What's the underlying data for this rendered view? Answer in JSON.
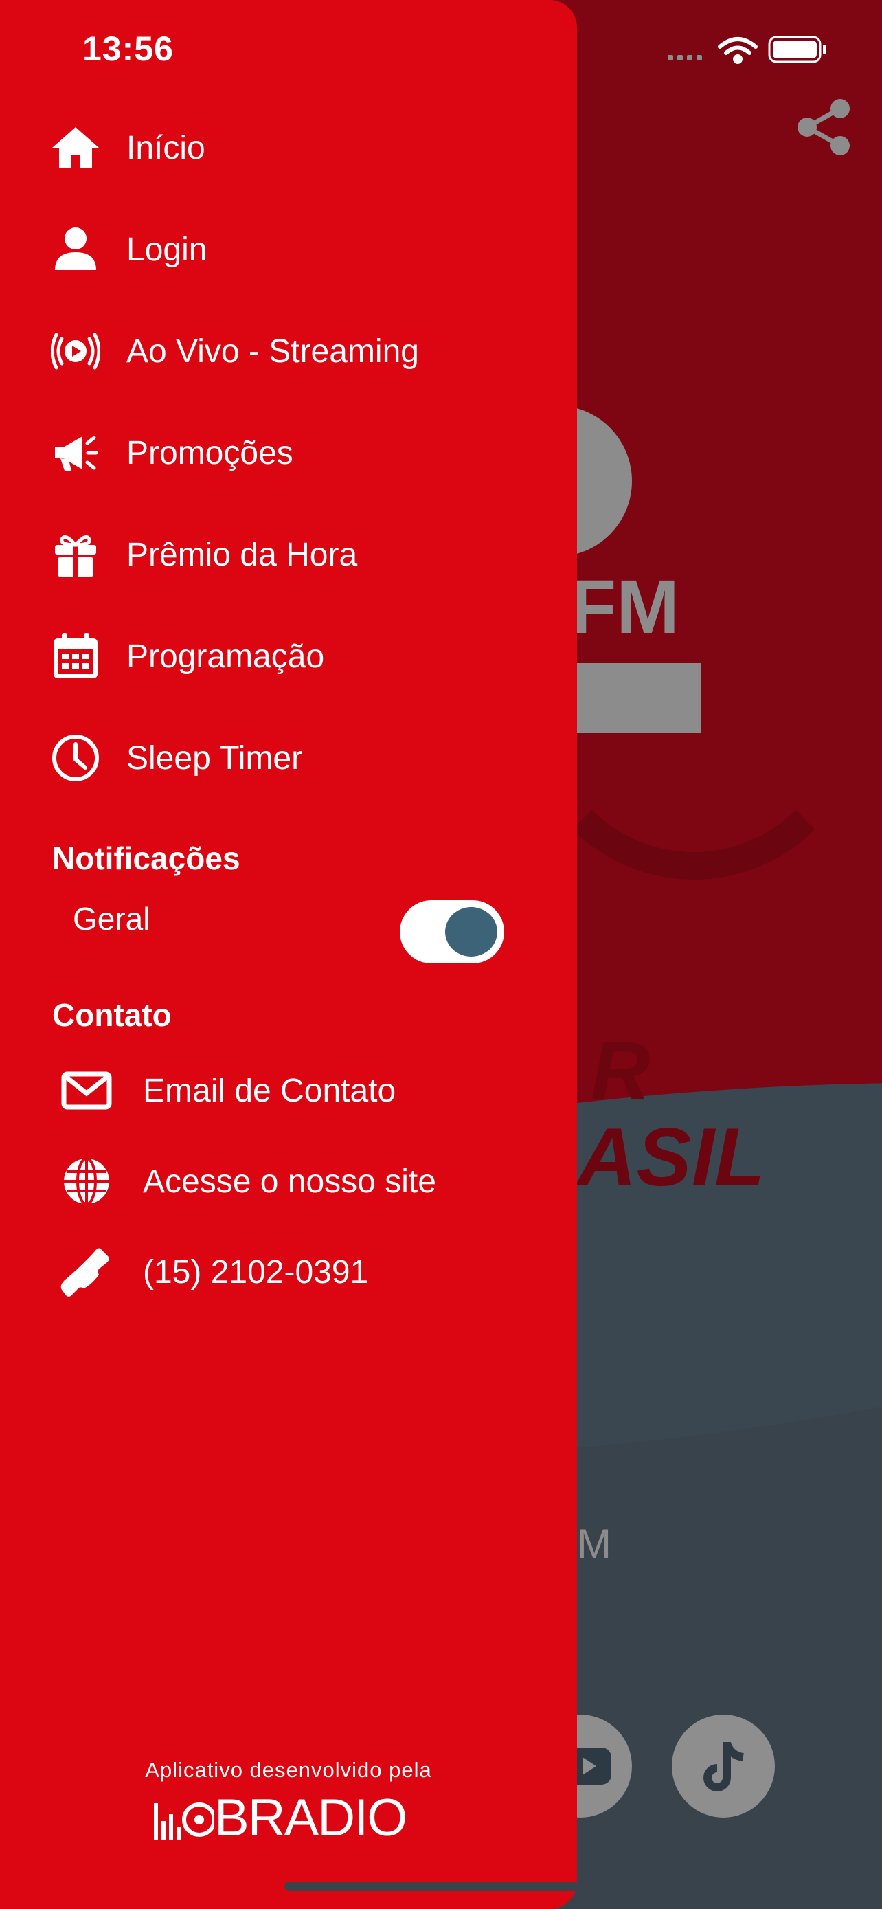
{
  "status_bar": {
    "time": "13:56"
  },
  "drawer": {
    "menu": [
      {
        "label": "Início",
        "icon": "home-icon"
      },
      {
        "label": "Login",
        "icon": "user-icon"
      },
      {
        "label": "Ao Vivo - Streaming",
        "icon": "live-stream-icon"
      },
      {
        "label": "Promoções",
        "icon": "megaphone-icon"
      },
      {
        "label": "Prêmio da Hora",
        "icon": "gift-icon"
      },
      {
        "label": "Programação",
        "icon": "calendar-icon"
      },
      {
        "label": "Sleep Timer",
        "icon": "clock-icon"
      }
    ],
    "notifications": {
      "title": "Notificações",
      "general_label": "Geral",
      "general_enabled": true
    },
    "contact": {
      "title": "Contato",
      "items": [
        {
          "label": "Email de Contato",
          "icon": "envelope-icon"
        },
        {
          "label": "Acesse o nosso site",
          "icon": "globe-icon"
        },
        {
          "label": "(15) 2102-0391",
          "icon": "phone-icon"
        }
      ]
    },
    "footer": {
      "developed_by": "Aplicativo desenvolvido pela",
      "brand": "MOBRADIO"
    }
  },
  "background": {
    "logo_suffix": "FM",
    "slogan_fragment_1": "R",
    "slogan_fragment_2": "ASIL",
    "station_fragment": "M"
  },
  "colors": {
    "drawer_red": "#dc0612",
    "background_dark_red": "#7e0612",
    "background_slate": "#38434c",
    "toggle_knob": "#3d6378"
  }
}
